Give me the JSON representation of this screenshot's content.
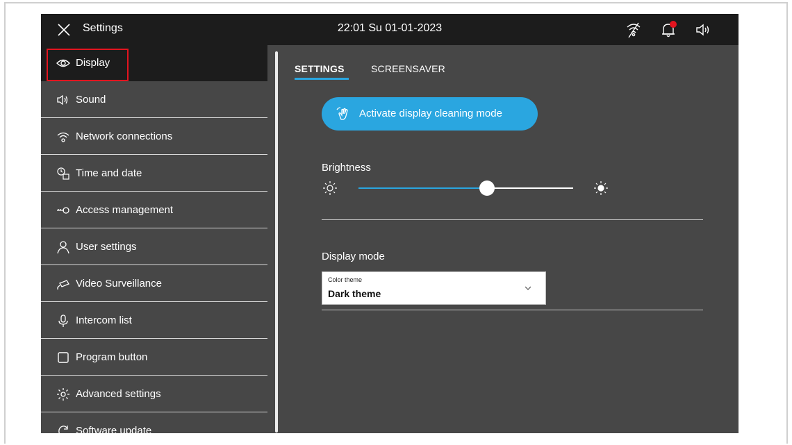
{
  "header": {
    "title": "Settings",
    "clock": "22:01  Su 01-01-2023",
    "icons": [
      "close-icon",
      "wifi-off-icon",
      "bell-notification-icon",
      "speaker-icon"
    ],
    "notification_color": "#e3141f"
  },
  "sidebar": {
    "items": [
      {
        "label": "Display",
        "icon": "eye-icon",
        "active": true
      },
      {
        "label": "Sound",
        "icon": "speaker-icon"
      },
      {
        "label": "Network connections",
        "icon": "wifi-icon"
      },
      {
        "label": "Time and date",
        "icon": "clock-calendar-icon"
      },
      {
        "label": "Access  management",
        "icon": "key-icon"
      },
      {
        "label": "User settings",
        "icon": "user-icon"
      },
      {
        "label": "Video Surveillance",
        "icon": "camera-icon"
      },
      {
        "label": "Intercom list",
        "icon": "microphone-icon"
      },
      {
        "label": "Program button",
        "icon": "square-icon"
      },
      {
        "label": "Advanced settings",
        "icon": "gear-icon"
      },
      {
        "label": "Software update",
        "icon": "refresh-icon"
      }
    ]
  },
  "tabs": {
    "settings": "SETTINGS",
    "screensaver": "SCREENSAVER",
    "active": "SETTINGS"
  },
  "main": {
    "clean_button_label": "Activate display cleaning mode",
    "brightness_label": "Brightness",
    "brightness_level": 0.6,
    "display_mode_label": "Display mode",
    "color_theme": {
      "caption": "Color theme",
      "value": "Dark theme"
    }
  },
  "colors": {
    "accent": "#2aa6e0",
    "background": "#474747",
    "topbar": "#1c1c1c",
    "highlight": "#e3141f"
  }
}
